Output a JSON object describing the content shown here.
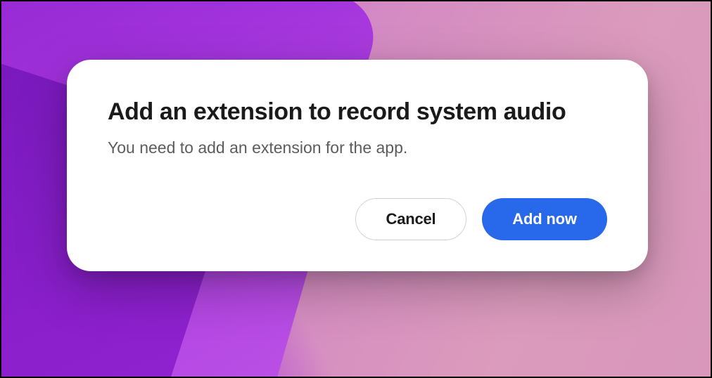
{
  "modal": {
    "title": "Add an extension to record system audio",
    "body": "You need to add an extension for the app.",
    "cancel_label": "Cancel",
    "confirm_label": "Add now"
  }
}
